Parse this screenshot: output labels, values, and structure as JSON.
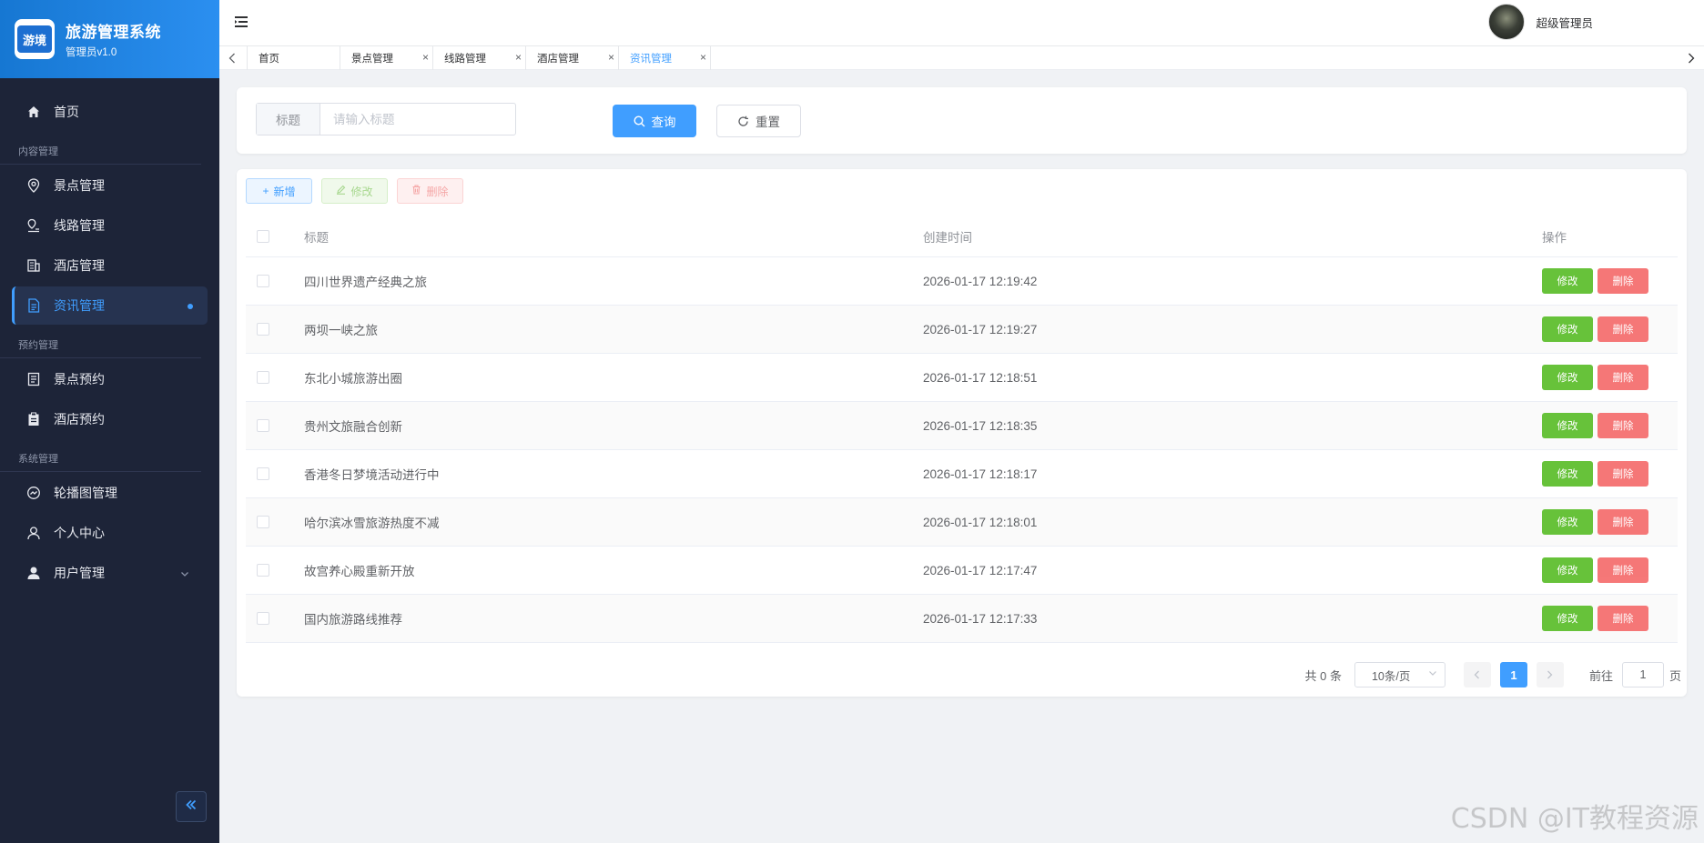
{
  "brand": {
    "logo_text": "游境",
    "title": "旅游管理系统",
    "subtitle": "管理员v1.0"
  },
  "sidebar": {
    "items": [
      {
        "label": "首页",
        "icon": "home-icon"
      },
      {
        "group": "内容管理"
      },
      {
        "label": "景点管理",
        "icon": "location-pin-icon"
      },
      {
        "label": "线路管理",
        "icon": "route-icon"
      },
      {
        "label": "酒店管理",
        "icon": "building-icon"
      },
      {
        "label": "资讯管理",
        "icon": "document-icon",
        "active": true
      },
      {
        "group": "预约管理"
      },
      {
        "label": "景点预约",
        "icon": "ticket-icon"
      },
      {
        "label": "酒店预约",
        "icon": "clipboard-icon"
      },
      {
        "group": "系统管理"
      },
      {
        "label": "轮播图管理",
        "icon": "carousel-icon"
      },
      {
        "label": "个人中心",
        "icon": "user-icon"
      },
      {
        "label": "用户管理",
        "icon": "users-icon"
      }
    ]
  },
  "topbar": {
    "username": "超级管理员"
  },
  "tabs": [
    {
      "label": "首页"
    },
    {
      "label": "景点管理"
    },
    {
      "label": "线路管理"
    },
    {
      "label": "酒店管理"
    },
    {
      "label": "资讯管理",
      "active": true
    }
  ],
  "search": {
    "field_label": "标题",
    "placeholder": "请输入标题",
    "query_label": "查询",
    "reset_label": "重置"
  },
  "toolbar": {
    "add_label": "新增",
    "edit_label": "修改",
    "delete_label": "删除"
  },
  "table": {
    "headers": {
      "title": "标题",
      "created": "创建时间",
      "ops": "操作"
    },
    "op_edit": "修改",
    "op_delete": "删除",
    "rows": [
      {
        "title": "四川世界遗产经典之旅",
        "created": "2026-01-17 12:19:42"
      },
      {
        "title": "两坝一峡之旅",
        "created": "2026-01-17 12:19:27"
      },
      {
        "title": "东北小城旅游出圈",
        "created": "2026-01-17 12:18:51"
      },
      {
        "title": "贵州文旅融合创新",
        "created": "2026-01-17 12:18:35"
      },
      {
        "title": "香港冬日梦境活动进行中",
        "created": "2026-01-17 12:18:17"
      },
      {
        "title": "哈尔滨冰雪旅游热度不减",
        "created": "2026-01-17 12:18:01"
      },
      {
        "title": "故宫养心殿重新开放",
        "created": "2026-01-17 12:17:47"
      },
      {
        "title": "国内旅游路线推荐",
        "created": "2026-01-17 12:17:33"
      }
    ]
  },
  "pager": {
    "total": "共 0 条",
    "page_size": "10条/页",
    "current_page": "1",
    "goto_prefix": "前往",
    "goto_value": "1",
    "goto_suffix": "页"
  },
  "watermark": "CSDN @IT教程资源"
}
